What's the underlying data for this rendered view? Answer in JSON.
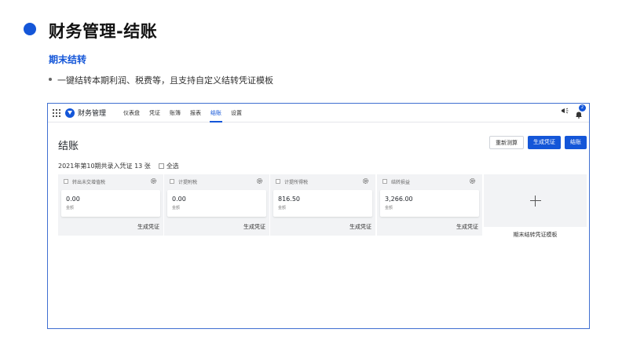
{
  "slide": {
    "title": "财务管理-结账",
    "subtitle": "期末结转",
    "bullet": "一键结转本期利润、税费等，且支持自定义结转凭证模板"
  },
  "app": {
    "name": "财务管理",
    "nav": [
      "仪表盘",
      "凭证",
      "账簿",
      "报表",
      "结账",
      "设置"
    ],
    "active_nav": "结账",
    "notification_count": "2"
  },
  "page": {
    "heading": "结账",
    "buttons": {
      "recalculate": "重新测算",
      "generate": "生成凭证",
      "close": "结账"
    },
    "period_text": "2021年第10期共录入凭证 13 张",
    "select_all": "全选"
  },
  "cards": [
    {
      "name": "转出未交增值税",
      "amount": "0.00",
      "amount_label": "金额",
      "action": "生成凭证"
    },
    {
      "name": "计提附税",
      "amount": "0.00",
      "amount_label": "金额",
      "action": "生成凭证"
    },
    {
      "name": "计提所得税",
      "amount": "816.50",
      "amount_label": "金额",
      "action": "生成凭证"
    },
    {
      "name": "结转损益",
      "amount": "3,266.00",
      "amount_label": "金额",
      "action": "生成凭证"
    }
  ],
  "add_template": "期末结转凭证模板",
  "colors": {
    "accent": "#1456d8",
    "card_bg": "#f2f3f5"
  }
}
